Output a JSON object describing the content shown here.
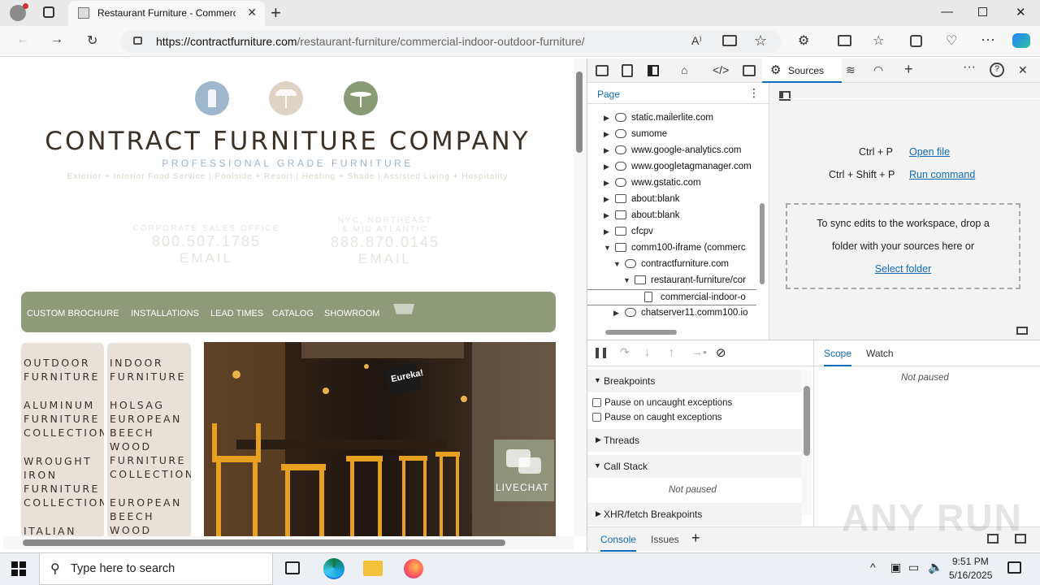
{
  "browser": {
    "tab_title": "Restaurant Furniture - Commercial Indoor Outdoor Furniture",
    "new_tab": "+",
    "url_domain": "https://contractfurniture.com",
    "url_path": "/restaurant-furniture/commercial-indoor-outdoor-furniture/"
  },
  "page": {
    "brand": "CONTRACT FURNITURE COMPANY",
    "subtitle": "PROFESSIONAL GRADE FURNITURE",
    "tagline": "Exterior + Interior Food Service | Poolside + Resort | Heating + Shade | Assisted Living + Hospitality",
    "contact1": {
      "label": "CORPORATE SALES OFFICE",
      "phone": "800.507.1785",
      "email": "EMAIL"
    },
    "contact2": {
      "label1": "NYC, NORTHEAST",
      "label2": "& MID ATLANTIC",
      "phone": "888.870.0145",
      "email": "EMAIL"
    },
    "nav": [
      "CUSTOM BROCHURE",
      "INSTALLATIONS",
      "LEAD TIMES",
      "CATALOG",
      "SHOWROOM"
    ],
    "left_col": [
      "OUTDOOR",
      "FURNITURE",
      "",
      "ALUMINUM",
      "FURNITURE",
      "COLLECTIONS",
      "",
      "WROUGHT",
      "IRON",
      "FURNITURE",
      "COLLECTIONS",
      "",
      "ITALIAN"
    ],
    "right_col": [
      "INDOOR",
      "FURNITURE",
      "",
      "HOLSAG",
      "EUROPEAN",
      "BEECH",
      "WOOD",
      "FURNITURE",
      "COLLECTION",
      "",
      "EUROPEAN",
      "BEECH",
      "WOOD"
    ],
    "photo_sign": "Eureka!",
    "livechat": "LIVECHAT"
  },
  "devtools": {
    "sources_tab": "Sources",
    "page_tab": "Page",
    "tree": [
      {
        "label": "static.mailerlite.com",
        "kind": "cloud",
        "indent": 0,
        "open": false
      },
      {
        "label": "sumome",
        "kind": "cloud",
        "indent": 0,
        "open": false
      },
      {
        "label": "www.google-analytics.com",
        "kind": "cloud",
        "indent": 0,
        "open": false
      },
      {
        "label": "www.googletagmanager.com",
        "kind": "cloud",
        "indent": 0,
        "open": false
      },
      {
        "label": "www.gstatic.com",
        "kind": "cloud",
        "indent": 0,
        "open": false
      },
      {
        "label": "about:blank",
        "kind": "window",
        "indent": 0,
        "open": false
      },
      {
        "label": "about:blank",
        "kind": "window",
        "indent": 0,
        "open": false
      },
      {
        "label": "cfcpv",
        "kind": "window",
        "indent": 0,
        "open": false
      },
      {
        "label": "comm100-iframe (commerc",
        "kind": "window",
        "indent": 0,
        "open": true
      },
      {
        "label": "contractfurniture.com",
        "kind": "cloud",
        "indent": 1,
        "open": true
      },
      {
        "label": "restaurant-furniture/cor",
        "kind": "folder",
        "indent": 2,
        "open": true
      },
      {
        "label": "commercial-indoor-o",
        "kind": "file",
        "indent": 3,
        "open": null
      },
      {
        "label": "chatserver11.comm100.io",
        "kind": "cloud",
        "indent": 1,
        "open": false
      }
    ],
    "shortcut1_keys": "Ctrl + P",
    "shortcut1_link": "Open file",
    "shortcut2_keys": "Ctrl + Shift + P",
    "shortcut2_link": "Run command",
    "sync_text1": "To sync edits to the workspace, drop a",
    "sync_text2": "folder with your sources here or",
    "sync_link": "Select folder",
    "scope_tab": "Scope",
    "watch_tab": "Watch",
    "not_paused": "Not paused",
    "breakpoints": "Breakpoints",
    "pause_uncaught": "Pause on uncaught exceptions",
    "pause_caught": "Pause on caught exceptions",
    "threads": "Threads",
    "call_stack": "Call Stack",
    "call_stack_status": "Not paused",
    "xhr": "XHR/fetch Breakpoints",
    "console_tab": "Console",
    "issues_tab": "Issues"
  },
  "taskbar": {
    "search_placeholder": "Type here to search",
    "time": "9:51 PM",
    "date": "5/16/2025"
  },
  "watermark": "ANY RUN"
}
